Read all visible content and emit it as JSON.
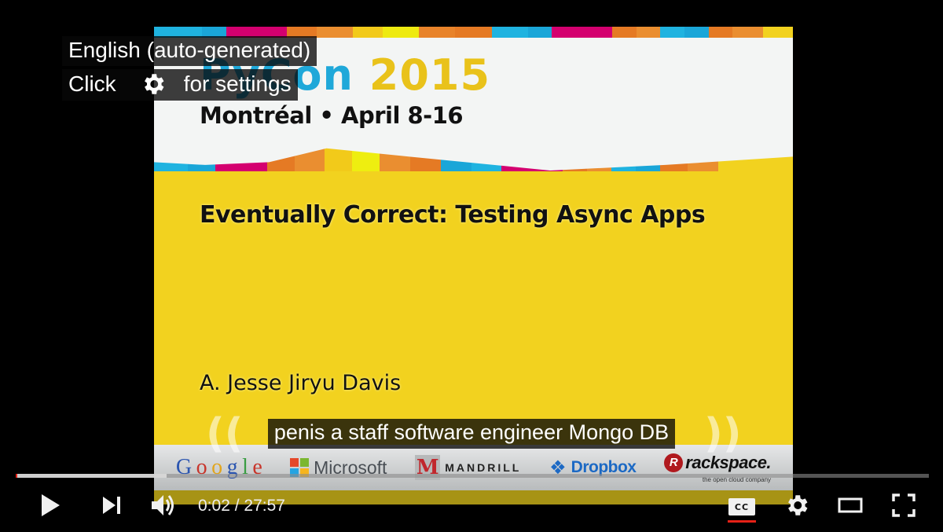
{
  "player": {
    "caption_hint": {
      "language_label": "English (auto-generated)",
      "click_label": "Click",
      "settings_label": "for settings",
      "icon": "gear-icon"
    },
    "subtitle_text": "penis a staff software engineer Mongo DB",
    "progress": {
      "played_fraction": 0.0012,
      "buffered_fraction": 0.165
    },
    "controls": {
      "play_icon": "play-icon",
      "next_icon": "next-icon",
      "volume_icon": "volume-icon",
      "current_time": "0:02",
      "separator": "/",
      "duration": "27:57",
      "cc_label": "CC",
      "cc_active": true,
      "settings_icon": "gear-icon",
      "theater_icon": "theater-mode-icon",
      "fullscreen_icon": "fullscreen-icon"
    },
    "accent_color": "#e62117"
  },
  "slide": {
    "logo_part1": "PyCon",
    "logo_part2": "2015",
    "subtitle": "Montréal • April 8-16",
    "talk_title": "Eventually Correct: Testing Async Apps",
    "speaker": "A. Jesse Jiryu Davis",
    "sponsors": {
      "google": [
        "G",
        "o",
        "o",
        "g",
        "l",
        "e"
      ],
      "microsoft": "Microsoft",
      "mandrill_mark": "M",
      "mandrill": "MANDRILL",
      "dropbox": "Dropbox",
      "rackspace": "rackspace.",
      "rackspace_tagline": "the open cloud company"
    },
    "stripe_colors": {
      "cyan": "#1fb3e0",
      "magenta": "#d4006f",
      "orange": "#e8832a",
      "yellow": "#f2d21f",
      "lime": "#eeee10"
    },
    "background_color": "#f2d21f"
  }
}
